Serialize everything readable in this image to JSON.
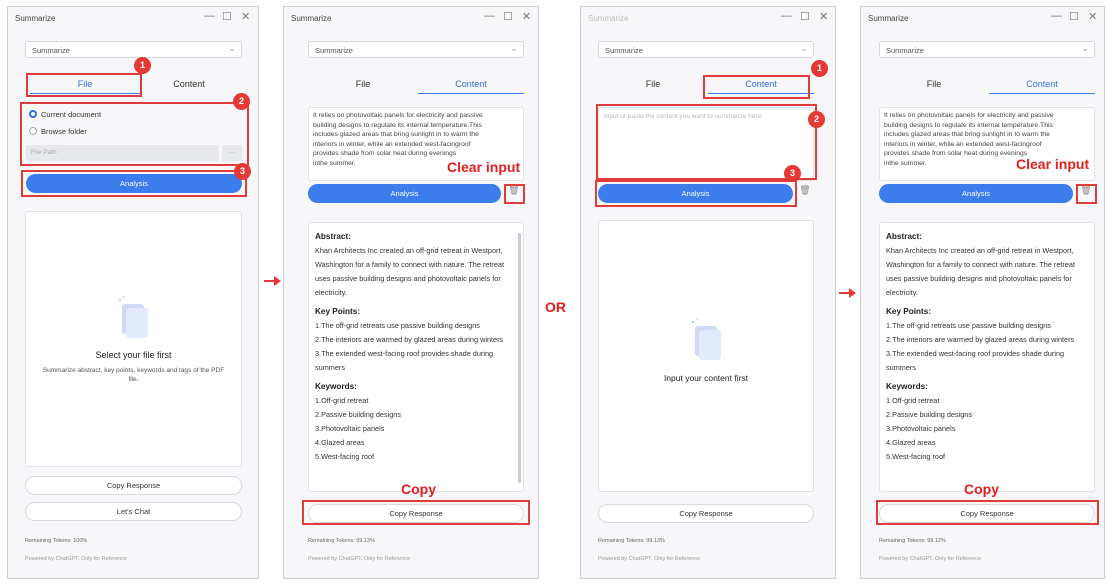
{
  "window_title": "Summarize",
  "controls": {
    "minimize": "—",
    "maximize": "☐",
    "close": "✕"
  },
  "dropdown": {
    "value": "Summarize",
    "chevron": "⌄"
  },
  "tabs": {
    "file": "File",
    "content": "Content"
  },
  "file_panel": {
    "current_document": "Current document",
    "browse_folder": "Browse folder",
    "file_path_placeholder": "File Path",
    "browse_button": "...",
    "empty_title": "Select your file first",
    "empty_desc": "Summarize abstract, key points, keywords and tags of the PDF file.",
    "let_chat": "Let's Chat",
    "tokens": "Remaining Tokens: 100%"
  },
  "analysis_label": "Analysis",
  "copy_response": "Copy Response",
  "footer": "Powered by ChatGPT. Only for Reference",
  "input_text": "It relies on photovoltaic panels for electricity and passive\nbuilding designs to regulate its internal temperature.This\nincludes glazed areas that bring sunlight in to warm the\ninteriors in winter, while an extended west-facingroof\nprovides shade from solar heat during evenings\ninthe summer.",
  "content_placeholder": "Input or paste the content you want to summarize here",
  "content_empty": "Input your content first",
  "tokens_used": "Remaining Tokens: 99.13%",
  "tokens_used_4": "Remaining Tokens: 99.12%",
  "result": {
    "abstract_h": "Abstract:",
    "abstract": "Khan Architects Inc created an off-grid retreat in Westport, Washington for a family to connect with nature. The retreat uses passive building designs and photovoltaic panels for electricity.",
    "key_h": "Key Points:",
    "k1": "1.The off-grid retreats use passive building designs",
    "k2": "2.The interiors are warmed by glazed areas during winters",
    "k3": "3.The extended west-facing roof provides shade during summers",
    "kw_h": "Keywords:",
    "w1": "1.Off-grid retreat",
    "w2": "2.Passive building designs",
    "w3": "3.Photovoltaic panels",
    "w4": "4.Glazed areas",
    "w5": "5.West-facing roof"
  },
  "annotations": {
    "clear_input": "Clear input",
    "copy": "Copy",
    "or": "OR",
    "n1": "1",
    "n2": "2",
    "n3": "3"
  },
  "colors": {
    "accent": "#3b7ded",
    "highlight": "#e03c3c"
  }
}
